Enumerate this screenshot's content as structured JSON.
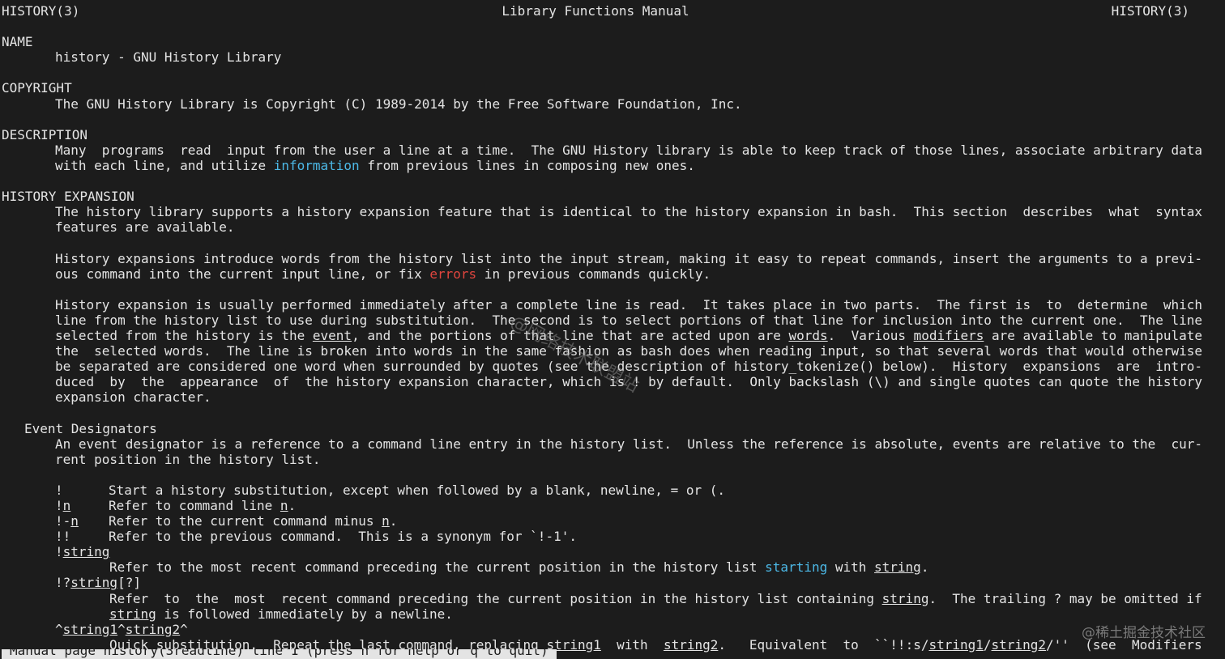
{
  "header": {
    "left": "HISTORY(3)",
    "center": "Library Functions Manual",
    "right": "HISTORY(3)"
  },
  "sections": {
    "name_h": "NAME",
    "name_body": "history - GNU History Library",
    "copyright_h": "COPYRIGHT",
    "copyright_body": "The GNU History Library is Copyright (C) 1989-2014 by the Free Software Foundation, Inc.",
    "description_h": "DESCRIPTION",
    "desc1a": "Many  programs  read  input from the user a line at a time.  The GNU History library is able to keep track of those lines, associate arbitrary data",
    "desc2a": "with each line, and utilize ",
    "desc2b": "information",
    "desc2c": " from previous lines in composing new ones.",
    "histexp_h": "HISTORY EXPANSION",
    "he1": "The history library supports a history expansion feature that is identical to the history expansion in bash.  This section  describes  what  syntax",
    "he2": "features are available.",
    "he3": "History expansions introduce words from the history list into the input stream, making it easy to repeat commands, insert the arguments to a previ-",
    "he4a": "ous command into the current input line, or fix ",
    "he4b": "errors",
    "he4c": " in previous commands quickly.",
    "he5": "History expansion is usually performed immediately after a complete line is read.  It takes place in two parts.  The first is  to  determine  which",
    "he6": "line from the history list to use during substitution.  The second is to select portions of that line for inclusion into the current one.  The line",
    "he7a": "selected from the history is the ",
    "he7b": "event",
    "he7c": ", and the portions of that line that are acted upon are ",
    "he7d": "words",
    "he7e": ".  Various ",
    "he7f": "modifiers",
    "he7g": " are available to manipulate",
    "he8": "the  selected words.  The line is broken into words in the same fashion as bash does when reading input, so that several words that would otherwise",
    "he9": "be separated are considered one word when surrounded by quotes (see the description of history_tokenize() below).  History  expansions  are  intro-",
    "he10": "duced  by  the  appearance  of  the history expansion character, which is ! by default.  Only backslash (\\) and single quotes can quote the history",
    "he11": "expansion character.",
    "event_h": "Event Designators",
    "ev1": "An event designator is a reference to a command line entry in the history list.  Unless the reference is absolute, events are relative to the  cur-",
    "ev2": "rent position in the history list."
  },
  "designators": {
    "d1k": "!",
    "d1v": "Start a history substitution, except when followed by a blank, newline, = or (.",
    "d2k1": "!",
    "d2k2": "n",
    "d2v1": "Refer to command line ",
    "d2v2": "n",
    "d2v3": ".",
    "d3k1": "!-",
    "d3k2": "n",
    "d3v1": "Refer to the current command minus ",
    "d3v2": "n",
    "d3v3": ".",
    "d4k": "!!",
    "d4v": "Refer to the previous command.  This is a synonym for `!-1'.",
    "d5k1": "!",
    "d5k2": "string",
    "d5v1": "Refer to the most recent command preceding the current position in the history list ",
    "d5v2": "starting",
    "d5v3": " with ",
    "d5v4": "string",
    "d5v5": ".",
    "d6k1": "!?",
    "d6k2": "string",
    "d6k3": "[?]",
    "d6v1": "Refer  to  the  most  recent command preceding the current position in the history list containing ",
    "d6v2": "string",
    "d6v3": ".  The trailing ? may be omitted if",
    "d6w1": "string",
    "d6w2": " is followed immediately by a newline.",
    "d7k1": "^",
    "d7k2": "string1",
    "d7k3": "^",
    "d7k4": "string2",
    "d7k5": "^",
    "d7v1": "Quick substitution.  Repeat the last command, replacing ",
    "d7v2": "string1",
    "d7v3": "  with  ",
    "d7v4": "string2",
    "d7v5": ".   Equivalent  to  ``!!:s/",
    "d7v6": "string1",
    "d7v7": "/",
    "d7v8": "string2",
    "d7v9": "/''  (see  Modifiers"
  },
  "status": "Manual page history(3readline) line 1 (press h for help or q to quit)",
  "watermark": "@稀土掘金技术社区",
  "watermark2": "@网络技术联盟站"
}
